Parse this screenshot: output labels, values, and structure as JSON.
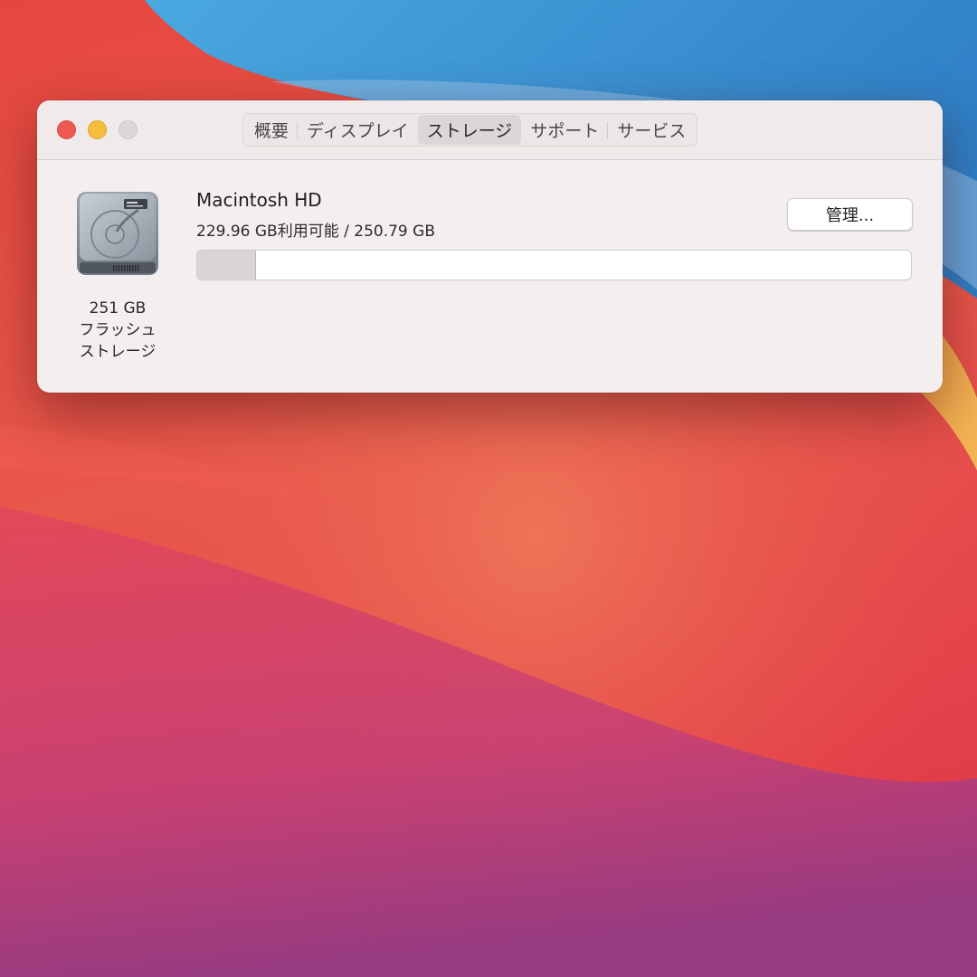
{
  "window": {
    "traffic_lights": {
      "close_color": "#ee5a52",
      "minimize_color": "#f5bd3a",
      "zoom_color": "#dcd7d6"
    },
    "tabs": [
      {
        "label": "概要",
        "active": false
      },
      {
        "label": "ディスプレイ",
        "active": false
      },
      {
        "label": "ストレージ",
        "active": true
      },
      {
        "label": "サポート",
        "active": false
      },
      {
        "label": "サービス",
        "active": false
      }
    ]
  },
  "storage": {
    "disk": {
      "icon": "hard-drive-icon",
      "size_label": "251 GB",
      "type_line1": "フラッシュ",
      "type_line2": "ストレージ"
    },
    "volume": {
      "name": "Macintosh HD",
      "availability": "229.96 GB利用可能 / 250.79 GB",
      "used_fraction": 0.083
    },
    "manage_button": "管理..."
  },
  "colors": {
    "window_bg": "#f4efee",
    "active_tab_bg": "#dcd7d6"
  }
}
